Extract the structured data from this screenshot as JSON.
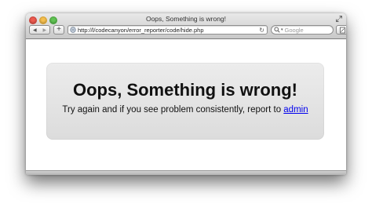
{
  "window": {
    "title": "Oops, Something is wrong!"
  },
  "toolbar": {
    "back_label": "◀",
    "forward_label": "▶",
    "add_label": "+",
    "url": "http://l/codecanyon/error_reporter/code/hide.php",
    "reload_label": "↻",
    "search_placeholder": "Google"
  },
  "page": {
    "heading": "Oops, Something is wrong!",
    "message": "Try again and if you see problem consistently, report to ",
    "link_text": "admin"
  },
  "colors": {
    "close": "#ee5b50",
    "minimize": "#f5bf4f",
    "zoom": "#61c454",
    "link": "#0000ee",
    "panel": "#e3e3e3"
  }
}
